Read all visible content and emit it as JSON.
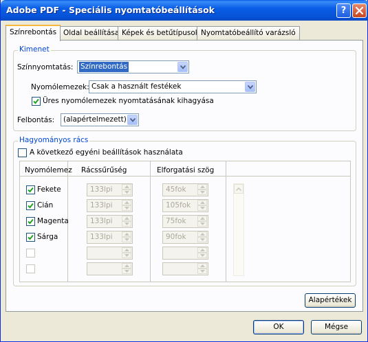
{
  "window": {
    "title": "Adobe PDF - Speciális nyomtatóbeállítások",
    "help_label": "?"
  },
  "tabs": [
    {
      "label": "Színrebontás"
    },
    {
      "label": "Oldal beállításai"
    },
    {
      "label": "Képek és betűtípusok"
    },
    {
      "label": "Nyomtatóbeállító varázsló"
    }
  ],
  "kimenet": {
    "legend": "Kimenet",
    "color_label": "Színnyomtatás:",
    "color_value": "Színrebontás",
    "plates_label": "Nyomólemezek:",
    "plates_value": "Csak a használt festékek",
    "skip_empty_label": "Üres nyomólemezek nyomtatásának kihagyása",
    "skip_empty_checked": true,
    "resolution_label": "Felbontás:",
    "resolution_value": "(alapértelmezett)"
  },
  "grid": {
    "legend": "Hagyományos rács",
    "custom_label": "A következő egyéni beállítások használata",
    "custom_checked": false,
    "columns": [
      "Nyomólemez",
      "Rácssűrűség",
      "Elforgatási szög"
    ],
    "rows": [
      {
        "name": "Fekete",
        "checked": true,
        "freq": "133lpi",
        "angle": "45fok"
      },
      {
        "name": "Cián",
        "checked": true,
        "freq": "133lpi",
        "angle": "105fok"
      },
      {
        "name": "Magenta",
        "checked": true,
        "freq": "133lpi",
        "angle": "75fok"
      },
      {
        "name": "Sárga",
        "checked": true,
        "freq": "133lpi",
        "angle": "90fok"
      },
      {
        "name": "",
        "checked": false,
        "freq": "",
        "angle": ""
      },
      {
        "name": "",
        "checked": false,
        "freq": "",
        "angle": ""
      }
    ],
    "defaults_label": "Alapértékek"
  },
  "footer": {
    "ok_label": "OK",
    "cancel_label": "Mégse"
  },
  "colors": {
    "title_bar": "#0a5ee6",
    "legend_text": "#0046d5",
    "selection": "#316ac5",
    "checkmark": "#21a121",
    "active_tab_accent": "#f5b63a"
  }
}
